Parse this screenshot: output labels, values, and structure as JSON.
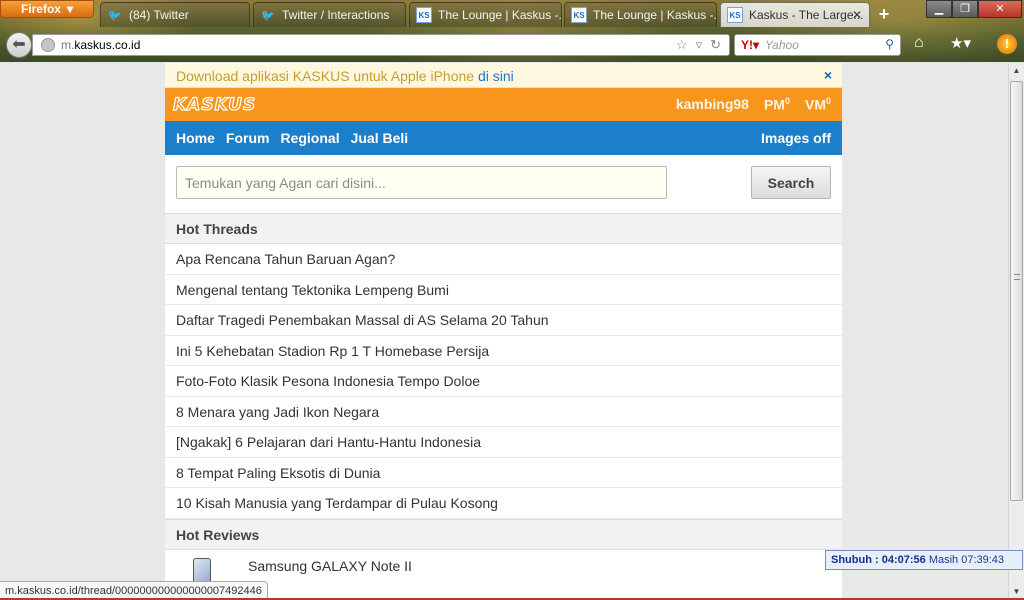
{
  "browser": {
    "menu_button": "Firefox",
    "tabs": [
      {
        "label": "(84) Twitter",
        "icon": "twitter-icon"
      },
      {
        "label": "Twitter / Interactions",
        "icon": "twitter-icon"
      },
      {
        "label": "The Lounge | Kaskus -...",
        "icon": "kaskus-icon"
      },
      {
        "label": "The Lounge | Kaskus -...",
        "icon": "kaskus-icon"
      },
      {
        "label": "Kaskus - The Large...",
        "icon": "kaskus-icon",
        "active": true
      }
    ],
    "url_prefix": "m.",
    "url_host": "kaskus.co.id",
    "search_placeholder": "Yahoo",
    "status_url": "m.kaskus.co.id/thread/000000000000000007492446"
  },
  "page": {
    "banner": {
      "text": "Download aplikasi KASKUS untuk Apple iPhone ",
      "link": "di sini",
      "close": "×"
    },
    "header": {
      "logo": "KASKUS",
      "username": "kambing98",
      "pm_label": "PM",
      "pm_count": "0",
      "vm_label": "VM",
      "vm_count": "0"
    },
    "nav": {
      "items": [
        "Home",
        "Forum",
        "Regional",
        "Jual Beli"
      ],
      "images_off": "Images off"
    },
    "search": {
      "placeholder": "Temukan yang Agan cari disini...",
      "button": "Search"
    },
    "hot_threads": {
      "title": "Hot Threads",
      "items": [
        "Apa Rencana Tahun Baruan Agan?",
        "Mengenal tentang Tektonika Lempeng Bumi",
        "Daftar Tragedi Penembakan Massal di AS Selama 20 Tahun",
        "Ini 5 Kehebatan Stadion Rp 1 T Homebase Persija",
        "Foto-Foto Klasik Pesona Indonesia Tempo Doloe",
        "8 Menara yang Jadi Ikon Negara",
        "[Ngakak] 6 Pelajaran dari Hantu-Hantu Indonesia",
        "8 Tempat Paling Eksotis di Dunia",
        "10 Kisah Manusia yang Terdampar di Pulau Kosong"
      ]
    },
    "hot_reviews": {
      "title": "Hot Reviews",
      "items": [
        "Samsung GALAXY Note II"
      ]
    }
  },
  "clock": {
    "label": "Shubuh : 04:07:56",
    "remaining": "Masih 07:39:43"
  },
  "colors": {
    "orange": "#f8951d",
    "blue": "#1b7fcc",
    "banner_bg": "#fff8e1"
  }
}
